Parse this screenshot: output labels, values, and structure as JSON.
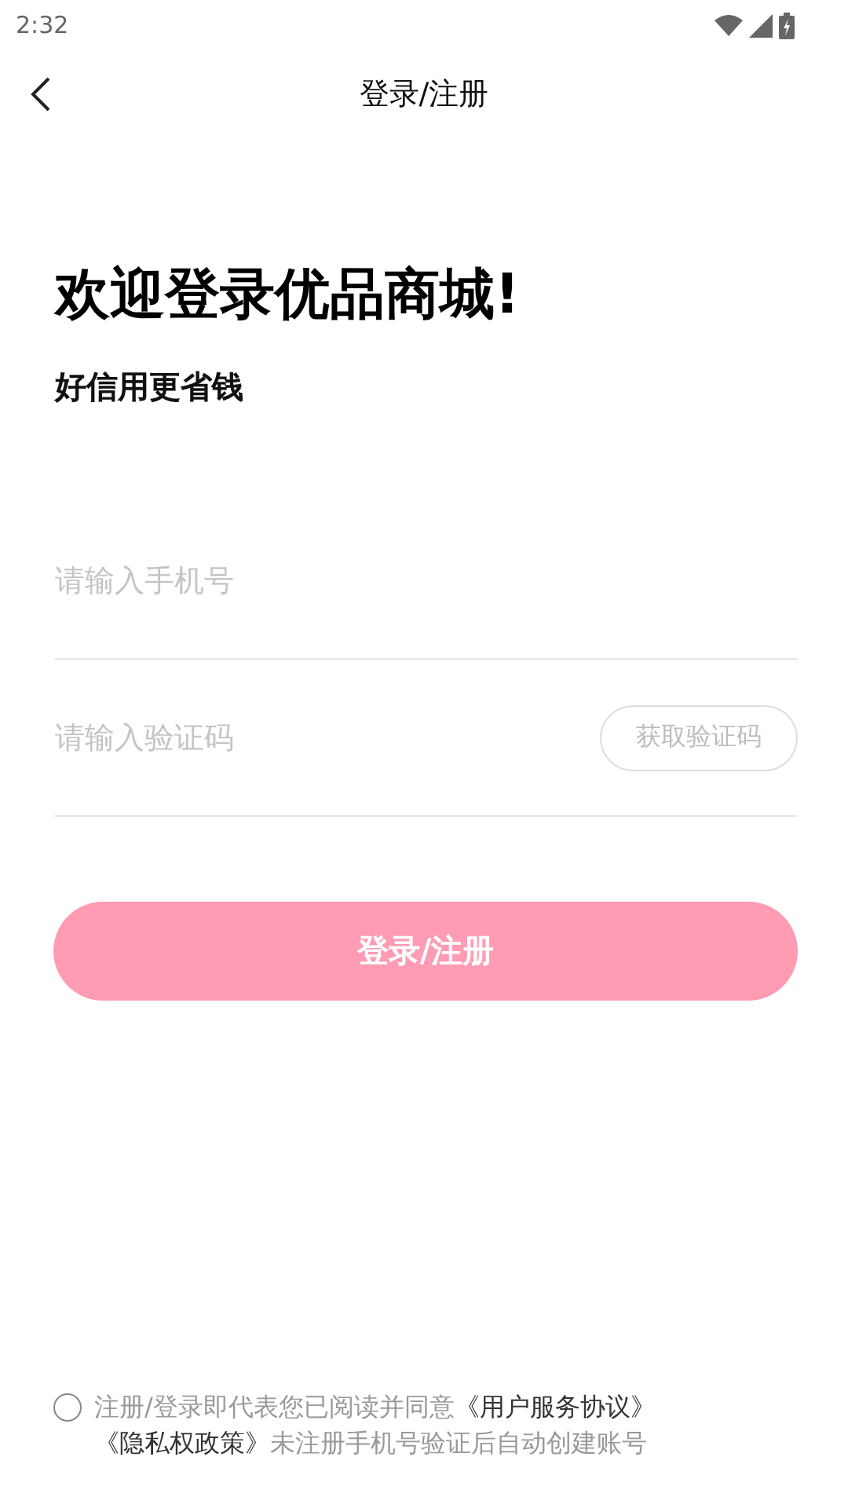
{
  "status_bar": {
    "time": "2:32"
  },
  "header": {
    "title": "登录/注册"
  },
  "welcome": {
    "title": "欢迎登录优品商城!",
    "subtitle": "好信用更省钱"
  },
  "phone_field": {
    "placeholder": "请输入手机号"
  },
  "code_field": {
    "placeholder": "请输入验证码"
  },
  "get_code_button": {
    "label": "获取验证码",
    "disabled": true
  },
  "login_button": {
    "label": "登录/注册",
    "disabled": true
  },
  "agreement": {
    "checked": false,
    "parts": [
      {
        "kind": "text",
        "text": "注册/登录即代表您已阅读并同意"
      },
      {
        "kind": "link",
        "text": "《用户服务协议》"
      },
      {
        "kind": "link",
        "text": "《隐私权政策》"
      },
      {
        "kind": "text",
        "text": "未注册手机号验证后自动创建账号"
      }
    ]
  }
}
